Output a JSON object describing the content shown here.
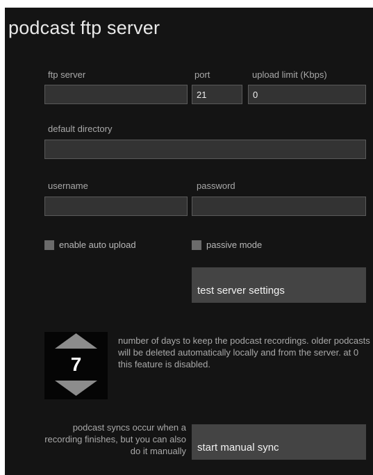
{
  "title": "podcast ftp server",
  "fields": {
    "ftp_server": {
      "label": "ftp server",
      "value": ""
    },
    "port": {
      "label": "port",
      "value": "21"
    },
    "upload_limit": {
      "label": "upload limit (Kbps)",
      "value": "0"
    },
    "default_directory": {
      "label": "default directory",
      "value": ""
    },
    "username": {
      "label": "username",
      "value": ""
    },
    "password": {
      "label": "password",
      "value": ""
    }
  },
  "checkboxes": {
    "auto_upload": {
      "label": "enable auto upload",
      "checked": false
    },
    "passive_mode": {
      "label": "passive mode",
      "checked": false
    }
  },
  "buttons": {
    "test": "test server settings",
    "sync": "start manual sync"
  },
  "retention": {
    "days": "7",
    "description": "number of days to keep the podcast recordings. older podcasts will be deleted automatically locally and from the server. at 0 this feature is disabled."
  },
  "sync_note": "podcast syncs occur when a recording finishes, but you can also do it manually",
  "colors": {
    "background": "#141414",
    "input": "#333333",
    "button": "#444444",
    "arrow": "#8c8c8c"
  },
  "icons": [
    "up-arrow-icon",
    "down-arrow-icon"
  ]
}
